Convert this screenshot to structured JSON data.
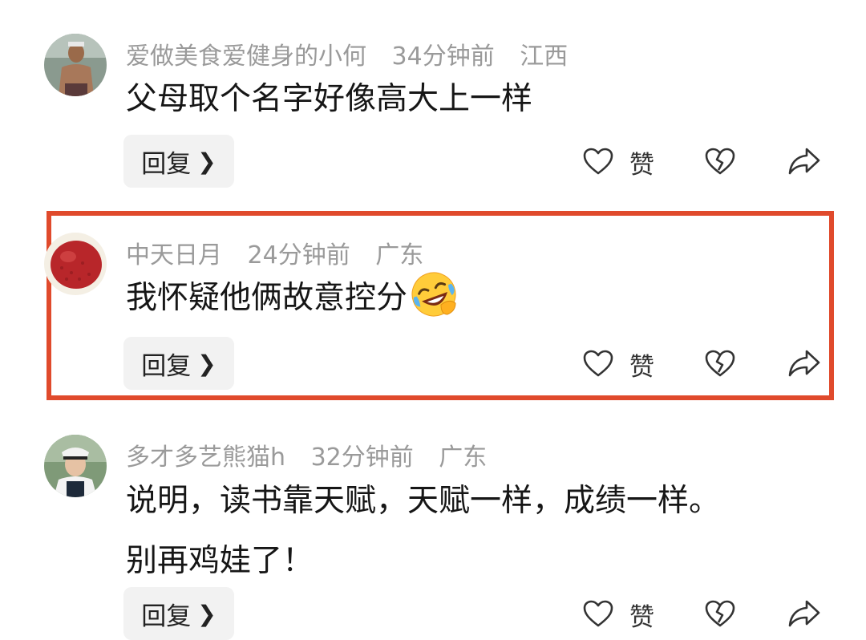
{
  "comments": [
    {
      "username": "爱做美食爱健身的小何",
      "time": "34分钟前",
      "location": "江西",
      "text": [
        "父母取个名字好像高大上一样"
      ],
      "reply_label": "回复",
      "like_label": "赞",
      "avatar_desc": "shirtless-man-avatar"
    },
    {
      "username": "中天日月",
      "time": "24分钟前",
      "location": "广东",
      "text": [
        "我怀疑他俩故意控分"
      ],
      "emoji": "rofl-face-emoji",
      "reply_label": "回复",
      "like_label": "赞",
      "avatar_desc": "lychee-avatar",
      "highlighted": true,
      "highlight_color": "#e04a2c"
    },
    {
      "username": "多才多艺熊猫h",
      "time": "32分钟前",
      "location": "广东",
      "text": [
        "说明，读书靠天赋，天赋一样，成绩一样。",
        "别再鸡娃了！"
      ],
      "reply_label": "回复",
      "like_label": "赞",
      "avatar_desc": "uniformed-man-avatar"
    }
  ],
  "icons": {
    "like": "heart-icon",
    "dislike": "broken-heart-icon",
    "share": "share-arrow-icon",
    "reply_chevron": "chevron-right-icon"
  }
}
